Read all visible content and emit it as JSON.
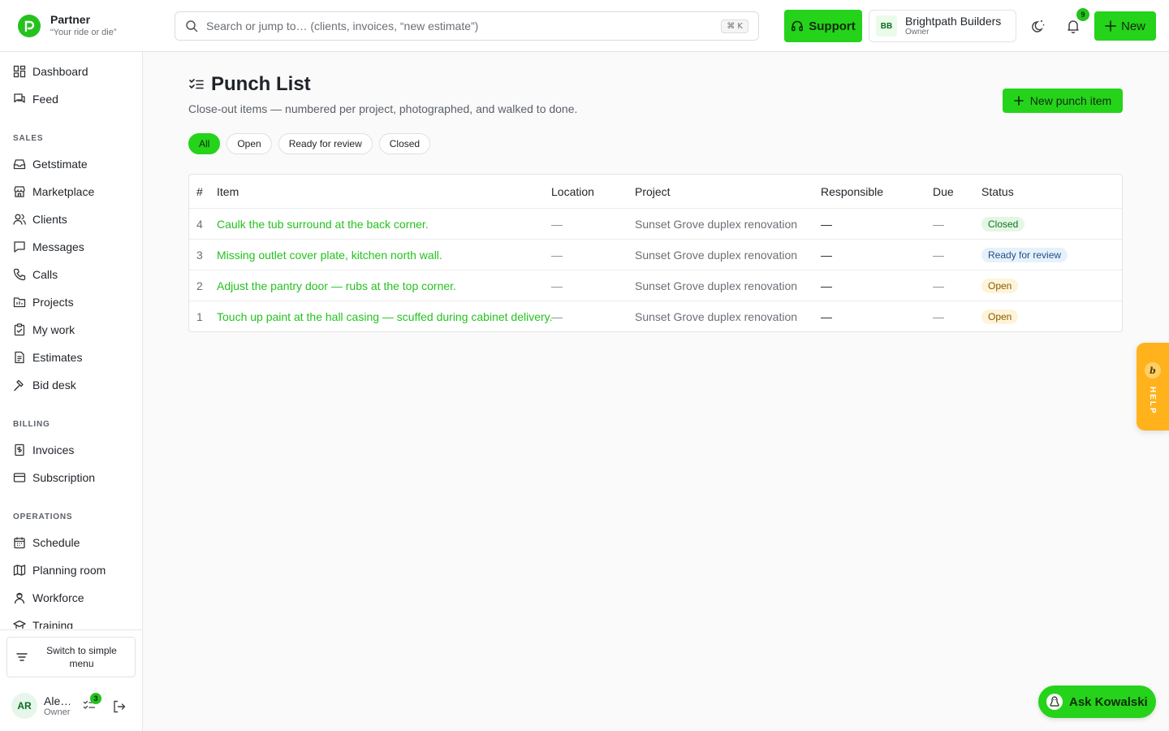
{
  "brand": {
    "name": "Partner",
    "tagline": "“Your ride or die”"
  },
  "search": {
    "placeholder": "Search or jump to… (clients, invoices, “new estimate”)",
    "shortcut": "⌘ K"
  },
  "header": {
    "support_label": "Support",
    "org_initials": "BB",
    "org_name": "Brightpath Builders",
    "org_role": "Owner",
    "notification_count": "9",
    "new_label": "New"
  },
  "sidebar": {
    "top": [
      {
        "label": "Dashboard",
        "icon": "dashboard-icon"
      },
      {
        "label": "Feed",
        "icon": "feed-icon"
      }
    ],
    "sections": [
      {
        "title": "SALES",
        "items": [
          {
            "label": "Getstimate",
            "icon": "inbox-icon"
          },
          {
            "label": "Marketplace",
            "icon": "store-icon"
          },
          {
            "label": "Clients",
            "icon": "users-icon"
          },
          {
            "label": "Messages",
            "icon": "message-icon"
          },
          {
            "label": "Calls",
            "icon": "phone-icon"
          },
          {
            "label": "Projects",
            "icon": "folder-icon"
          },
          {
            "label": "My work",
            "icon": "clipboard-check-icon"
          },
          {
            "label": "Estimates",
            "icon": "document-icon"
          },
          {
            "label": "Bid desk",
            "icon": "gavel-icon"
          }
        ]
      },
      {
        "title": "BILLING",
        "items": [
          {
            "label": "Invoices",
            "icon": "invoice-icon"
          },
          {
            "label": "Subscription",
            "icon": "credit-card-icon"
          }
        ]
      },
      {
        "title": "OPERATIONS",
        "items": [
          {
            "label": "Schedule",
            "icon": "calendar-icon"
          },
          {
            "label": "Planning room",
            "icon": "map-icon"
          },
          {
            "label": "Workforce",
            "icon": "worker-icon"
          },
          {
            "label": "Training",
            "icon": "graduation-cap-icon"
          }
        ]
      }
    ],
    "switch_label": "Switch to simple menu",
    "user": {
      "initials": "AR",
      "name": "Ale…",
      "role": "Owner",
      "task_count": "3"
    }
  },
  "page": {
    "title": "Punch List",
    "subtitle": "Close-out items — numbered per project, photographed, and walked to done.",
    "new_button": "New punch item",
    "filters": [
      {
        "label": "All",
        "active": true
      },
      {
        "label": "Open",
        "active": false
      },
      {
        "label": "Ready for review",
        "active": false
      },
      {
        "label": "Closed",
        "active": false
      }
    ],
    "table": {
      "columns": [
        "#",
        "Item",
        "Location",
        "Project",
        "Responsible",
        "Due",
        "Status"
      ],
      "rows": [
        {
          "num": "4",
          "item": "Caulk the tub surround at the back corner.",
          "location": "—",
          "project": "Sunset Grove duplex renovation",
          "responsible": "—",
          "due": "—",
          "status": "Closed",
          "status_kind": "closed"
        },
        {
          "num": "3",
          "item": "Missing outlet cover plate, kitchen north wall.",
          "location": "—",
          "project": "Sunset Grove duplex renovation",
          "responsible": "—",
          "due": "—",
          "status": "Ready for review",
          "status_kind": "review"
        },
        {
          "num": "2",
          "item": "Adjust the pantry door — rubs at the top corner.",
          "location": "—",
          "project": "Sunset Grove duplex renovation",
          "responsible": "—",
          "due": "—",
          "status": "Open",
          "status_kind": "open"
        },
        {
          "num": "1",
          "item": "Touch up paint at the hall casing — scuffed during cabinet delivery.",
          "location": "—",
          "project": "Sunset Grove duplex renovation",
          "responsible": "—",
          "due": "—",
          "status": "Open",
          "status_kind": "open"
        }
      ]
    }
  },
  "help_tab": {
    "glyph": "b",
    "label": "HELP"
  },
  "assistant": {
    "label": "Ask Kowalski"
  },
  "colors": {
    "accent": "#25d31a",
    "link": "#25c21e",
    "help": "#ffb21c"
  }
}
